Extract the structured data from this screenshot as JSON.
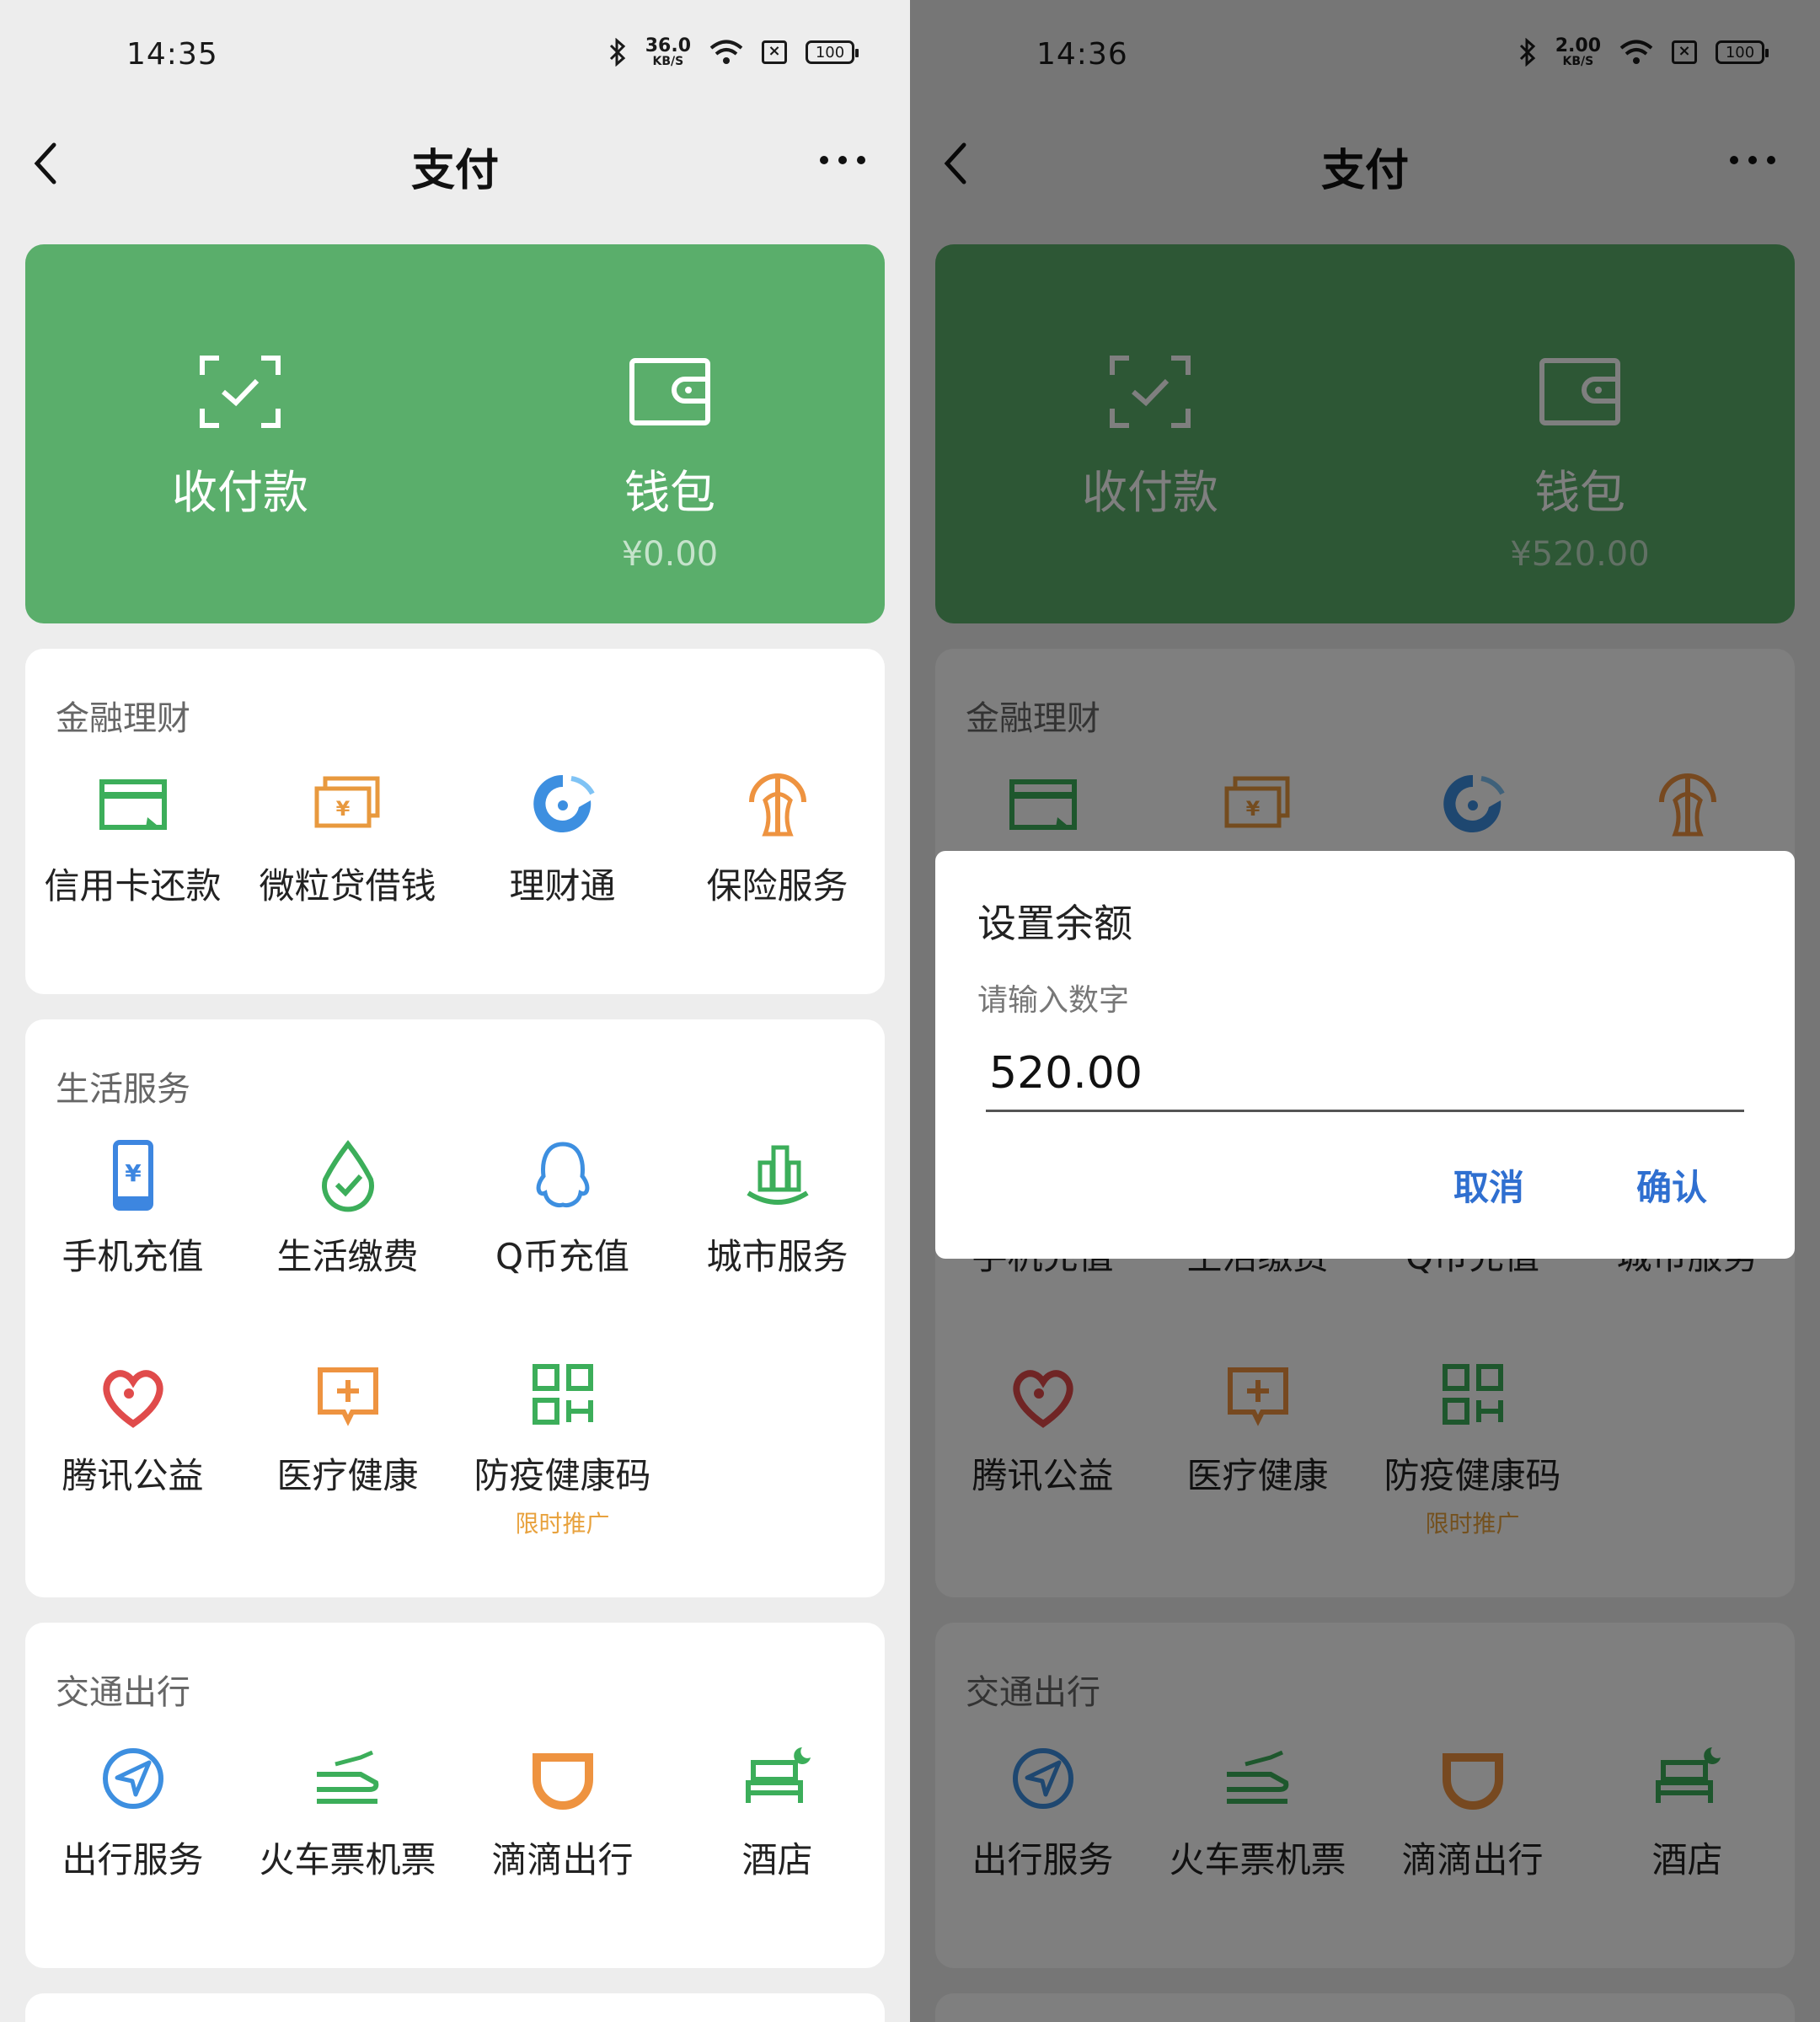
{
  "left": {
    "status": {
      "time": "14:35",
      "speed_num": "36.0",
      "speed_unit": "KB/S",
      "battery": "100"
    },
    "title": "支付",
    "hero": {
      "collect_label": "收付款",
      "wallet_label": "钱包",
      "wallet_amount": "¥0.00"
    }
  },
  "right": {
    "status": {
      "time": "14:36",
      "speed_num": "2.00",
      "speed_unit": "KB/S",
      "battery": "100"
    },
    "title": "支付",
    "hero": {
      "collect_label": "收付款",
      "wallet_label": "钱包",
      "wallet_amount": "¥520.00"
    }
  },
  "finance": {
    "title": "金融理财",
    "items": [
      {
        "label": "信用卡还款",
        "icon": "credit-card-icon"
      },
      {
        "label": "微粒贷借钱",
        "icon": "loan-icon"
      },
      {
        "label": "理财通",
        "icon": "wealth-icon"
      },
      {
        "label": "保险服务",
        "icon": "insurance-icon"
      }
    ]
  },
  "life": {
    "title": "生活服务",
    "items": [
      {
        "label": "手机充值",
        "icon": "phone-topup-icon"
      },
      {
        "label": "生活缴费",
        "icon": "bill-pay-icon"
      },
      {
        "label": "Q币充值",
        "icon": "qq-coin-icon"
      },
      {
        "label": "城市服务",
        "icon": "city-service-icon"
      },
      {
        "label": "腾讯公益",
        "icon": "charity-icon"
      },
      {
        "label": "医疗健康",
        "icon": "medical-icon"
      },
      {
        "label": "防疫健康码",
        "icon": "health-code-icon",
        "promo": "限时推广"
      }
    ]
  },
  "transport": {
    "title": "交通出行",
    "items": [
      {
        "label": "出行服务",
        "icon": "travel-icon"
      },
      {
        "label": "火车票机票",
        "icon": "train-plane-icon"
      },
      {
        "label": "滴滴出行",
        "icon": "didi-icon"
      },
      {
        "label": "酒店",
        "icon": "hotel-icon"
      }
    ]
  },
  "dialog": {
    "title": "设置余额",
    "hint": "请输入数字",
    "value": "520.00",
    "cancel": "取消",
    "confirm": "确认"
  },
  "colors": {
    "hero_green": "#5aae6b",
    "dialog_button": "#2f6fd0",
    "promo": "#e8a23e"
  }
}
